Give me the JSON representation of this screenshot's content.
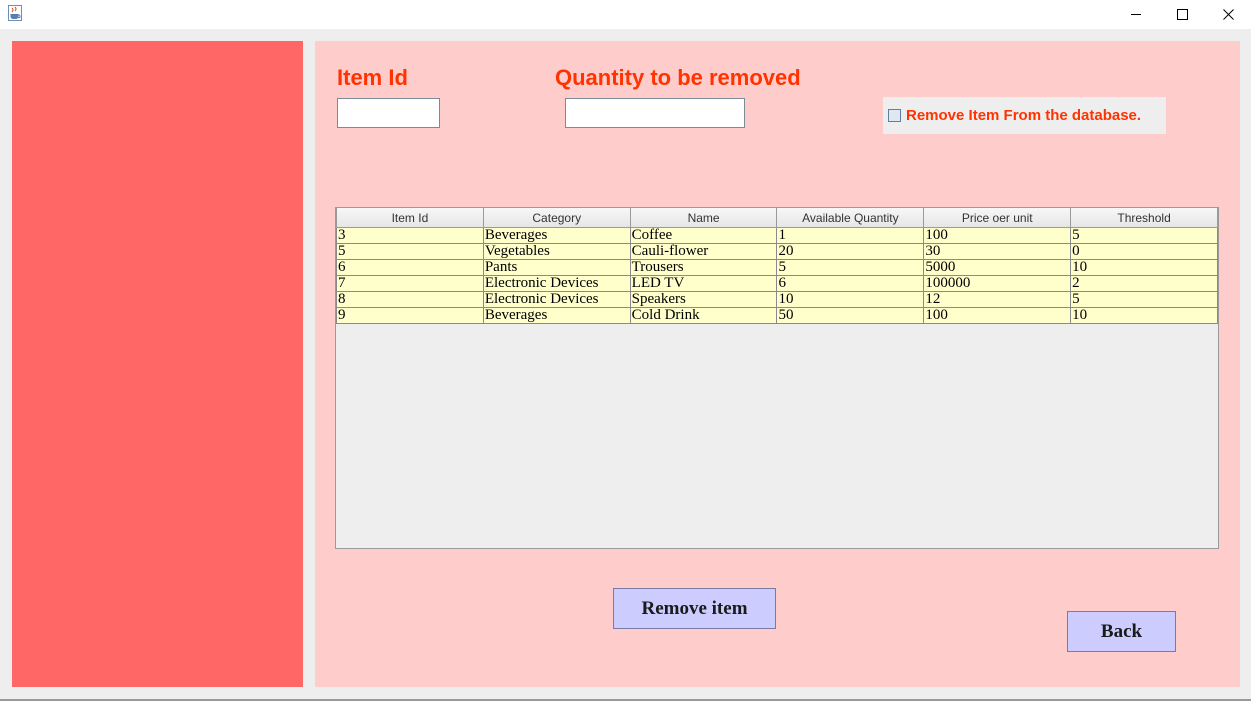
{
  "window": {
    "icon": "java-coffee-icon",
    "controls": [
      "minimize-icon",
      "maximize-icon",
      "close-icon"
    ]
  },
  "form": {
    "item_id_label": "Item Id",
    "item_id_value": "",
    "quantity_label": "Quantity to be removed",
    "quantity_value": "",
    "remove_checkbox_label": "Remove Item From the database.",
    "remove_checkbox_checked": false
  },
  "table": {
    "columns": [
      "Item Id",
      "Category",
      "Name",
      "Available Quantity",
      "Price oer unit",
      "Threshold"
    ],
    "rows": [
      [
        "3",
        "Beverages",
        "Coffee",
        "1",
        "100",
        "5"
      ],
      [
        "5",
        "Vegetables",
        "Cauli-flower",
        "20",
        "30",
        "0"
      ],
      [
        "6",
        "Pants",
        "Trousers",
        "5",
        "5000",
        "10"
      ],
      [
        "7",
        "Electronic Devices",
        "LED TV",
        "6",
        "100000",
        "2"
      ],
      [
        "8",
        "Electronic Devices",
        "Speakers",
        "10",
        "12",
        "5"
      ],
      [
        "9",
        "Beverages",
        "Cold Drink",
        "50",
        "100",
        "10"
      ]
    ]
  },
  "buttons": {
    "remove": "Remove item",
    "back": "Back"
  },
  "colors": {
    "left_panel": "#ff6666",
    "right_panel": "#ffcccc",
    "label_text": "#ff3300",
    "button_bg": "#ccccff",
    "table_row_bg": "#ffffcc"
  }
}
